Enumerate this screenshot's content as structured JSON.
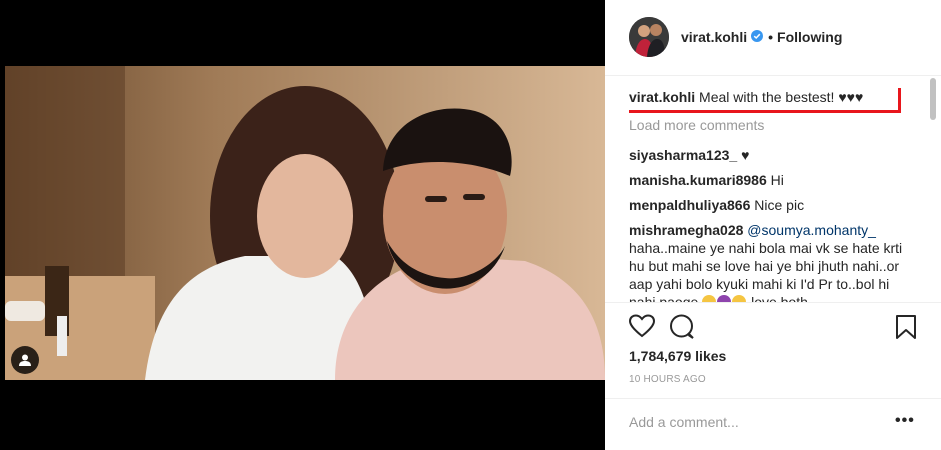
{
  "post": {
    "username": "virat.kohli",
    "follow_separator": "•",
    "follow_status": "Following",
    "caption_user": "virat.kohli",
    "caption_text": " Meal with the bestest! ♥♥♥",
    "load_more": "Load more comments",
    "likes": "1,784,679 likes",
    "time": "10 HOURS AGO",
    "add_comment_placeholder": "Add a comment...",
    "more_options": "•••"
  },
  "comments": [
    {
      "user": "siyasharma123_",
      "text": " ♥"
    },
    {
      "user": "manisha.kumari8986",
      "text": " Hi"
    },
    {
      "user": "menpaldhuliya866",
      "text": " Nice pic"
    }
  ],
  "long_comment": {
    "user": "mishramegha028",
    "mention": "@soumya.mohanty_",
    "text": "haha..maine ye nahi bola mai vk se hate krti hu but mahi se love hai ye bhi jhuth nahi..or aap yahi bolo kyuki mahi ki I'd Pr to..bol hi nahi paoge",
    "tail": " love both"
  },
  "colors": {
    "highlight": "#e8161c",
    "verified": "#3897f0",
    "mention": "#003569"
  },
  "icons": [
    "user-tag-icon",
    "verified-badge-icon",
    "heart-icon",
    "comment-icon",
    "bookmark-icon",
    "emoji-icon"
  ]
}
